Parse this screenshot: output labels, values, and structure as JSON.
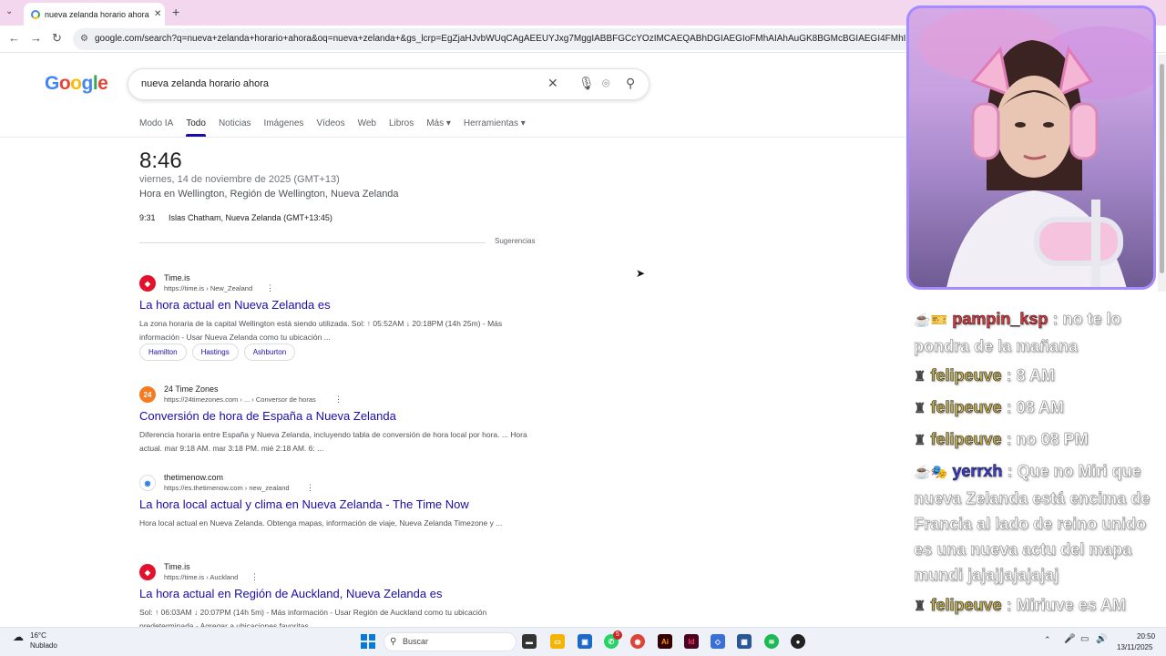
{
  "browser": {
    "tab_title": "nueva zelanda horario ahora - B",
    "url": "google.com/search?q=nueva+zelanda+horario+ahora&oq=nueva+zelanda+&gs_lcrp=EgZjaHJvbWUqCAgAEEUYJxg7MggIABBFGCcYOzIMCAEQABhDGIAEGIoFMhAIAhAuGK8BGMcBGIAEGI4FMhIIAxAAGEMYgwEYsQM"
  },
  "google": {
    "logo": [
      "G",
      "o",
      "o",
      "g",
      "l",
      "e"
    ],
    "logo_colors": [
      "#4285f4",
      "#ea4335",
      "#fbbc05",
      "#4285f4",
      "#34a853",
      "#ea4335"
    ],
    "query": "nueva zelanda horario ahora",
    "tabs": [
      "Modo IA",
      "Todo",
      "Noticias",
      "Imágenes",
      "Vídeos",
      "Web",
      "Libros",
      "Más ▾",
      "Herramientas ▾"
    ],
    "active_tab": "Todo"
  },
  "clock": {
    "time": "8:46",
    "date": "viernes, 14 de noviembre de 2025 (GMT+13)",
    "place": "Hora en Wellington, Región de Wellington, Nueva Zelanda",
    "secondary_time": "9:31",
    "secondary_place": "Islas Chatham, Nueva Zelanda (GMT+13:45)",
    "suggestions_label": "Sugerencias"
  },
  "results": [
    {
      "site": "Time.is",
      "url": "https://time.is › New_Zealand",
      "title": "La hora actual en Nueva Zelanda es",
      "snippet": "La zona horaria de la capital Wellington está siendo utilizada. Sol: ↑ 05:52AM ↓ 20:18PM (14h 25m) - Más información - Usar Nueva Zelanda como tu ubicación ...",
      "chips": [
        "Hamilton",
        "Hastings",
        "Ashburton"
      ],
      "icon": "time-is-icon",
      "icon_color": "#e3112c",
      "icon_glyph": "◆"
    },
    {
      "site": "24 Time Zones",
      "url": "https://24timezones.com › ... › Conversor de horas",
      "title": "Conversión de hora de España a Nueva Zelanda",
      "snippet": "Diferencia horaria entre España y Nueva Zelanda, incluyendo tabla de conversión de hora local por hora. ... Hora actual. mar 9:18 AM. mar 3:18 PM. mié 2:18 AM. 6: ...",
      "chips": [],
      "icon": "24timezones-icon",
      "icon_color": "#f47b20",
      "icon_glyph": "24"
    },
    {
      "site": "thetimenow.com",
      "url": "https://es.thetimenow.com › new_zealand",
      "title": "La hora local actual y clima en Nueva Zelanda - The Time Now",
      "snippet": "Hora local actual en Nueva Zelanda. Obtenga mapas, información de viaje, Nueva Zelanda Timezone y ...",
      "chips": [],
      "icon": "thetimenow-icon",
      "icon_color": "#ffffff",
      "icon_glyph": "◉"
    },
    {
      "site": "Time.is",
      "url": "https://time.is › Auckland",
      "title": "La hora actual en Región de Auckland, Nueva Zelanda es",
      "snippet": "Sol: ↑ 06:03AM ↓ 20:07PM (14h 5m) - Más información - Usar Región de Auckland como tu ubicación predeterminada - Agregar a ubicaciones favoritas ...",
      "chips": [],
      "icon": "time-is-icon",
      "icon_color": "#e3112c",
      "icon_glyph": "◆"
    }
  ],
  "chat": [
    {
      "user": "pampin_ksp",
      "color": "#e3343a",
      "badge": "☕🎫",
      "text": "no te lo pondra de la mañana"
    },
    {
      "user": "felipeuve",
      "color": "#c9b24a",
      "badge": "♜",
      "text": "8 AM"
    },
    {
      "user": "felipeuve",
      "color": "#c9b24a",
      "badge": "♜",
      "text": "08 AM"
    },
    {
      "user": "felipeuve",
      "color": "#c9b24a",
      "badge": "♜",
      "text": "no 08 PM"
    },
    {
      "user": "yerrxh",
      "color": "#3a3adf",
      "badge": "☕🎭",
      "text": "Que no Miri que nueva Zelanda está encima de Francia al lado de reino unido es una nueva actu del mapa mundi jajajjajajajaj"
    },
    {
      "user": "felipeuve",
      "color": "#c9b24a",
      "badge": "♜",
      "text": "Miriuve es AM"
    }
  ],
  "taskbar": {
    "weather_temp": "16°C",
    "weather_desc": "Nublado",
    "search_label": "Buscar",
    "time": "20:50",
    "date": "13/11/2025",
    "whatsapp_badge": "5"
  }
}
